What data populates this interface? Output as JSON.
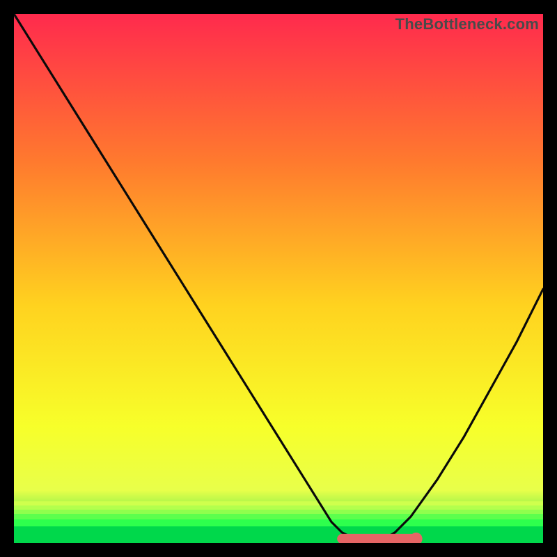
{
  "watermark": "TheBottleneck.com",
  "colors": {
    "bg_black": "#000000",
    "gradient_top": "#ff2a4d",
    "gradient_mid1": "#ff7a2e",
    "gradient_mid2": "#ffd21f",
    "gradient_mid3": "#f7ff2a",
    "gradient_bottom_yellow": "#e8ff4a",
    "gradient_green": "#00d84b",
    "curve_stroke": "#0a0a0a",
    "marker_red": "#e56666"
  },
  "chart_data": {
    "type": "line",
    "title": "",
    "xlabel": "",
    "ylabel": "",
    "xlim": [
      0,
      100
    ],
    "ylim": [
      0,
      100
    ],
    "x": [
      0,
      5,
      10,
      15,
      20,
      25,
      30,
      35,
      40,
      45,
      50,
      55,
      60,
      62,
      65,
      68,
      70,
      72,
      75,
      80,
      85,
      90,
      95,
      100
    ],
    "series": [
      {
        "name": "bottleneck-curve",
        "values": [
          100,
          92,
          84,
          76,
          68,
          60,
          52,
          44,
          36,
          28,
          20,
          12,
          4,
          2,
          0.5,
          0.5,
          0.8,
          2,
          5,
          12,
          20,
          29,
          38,
          48
        ]
      }
    ],
    "optimal_band": {
      "x_start": 62,
      "x_end": 76,
      "y": 0.8
    },
    "optimal_marker": {
      "x": 76,
      "y": 0.8
    },
    "annotations": []
  }
}
